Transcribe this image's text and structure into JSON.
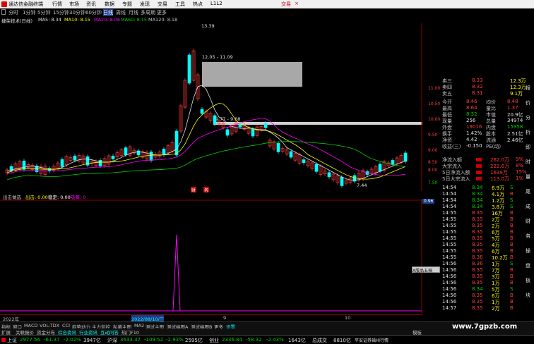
{
  "titlebar": {
    "app_name": "通达信金融终端",
    "menus": [
      "行情",
      "市场",
      "资讯",
      "数据",
      "专题",
      "发现",
      "交易",
      "工具",
      "热点",
      "L1L2"
    ],
    "broker": "交易",
    "close": "×"
  },
  "period_tabs": [
    "分时",
    "1分钟",
    "5分钟",
    "15分钟",
    "30分钟",
    "60分钟",
    "日线",
    "周线",
    "月线",
    "多周期",
    "更多"
  ],
  "period_selected": "日线",
  "ma_legend": [
    {
      "text": "MA5: 8.34",
      "color": "#e0e0e0"
    },
    {
      "text": "MA10: 8.15",
      "color": "#ffff00"
    },
    {
      "text": "MA20: 8.06",
      "color": "#ff00ff"
    },
    {
      "text": "MA60: 8.15",
      "color": "#00d000"
    },
    {
      "text": "MA120: 8.18",
      "color": "#c0c0c0"
    }
  ],
  "stock_title": "捷荣技术(日线)",
  "price_axis": [
    "11.00",
    "10.50",
    "10.00",
    "9.50",
    "9.00",
    "8.50",
    "8.00",
    "7.50"
  ],
  "current_price_tag": "8.20",
  "annotations": {
    "high": "13.39",
    "range1": "12.05 - 11.09",
    "range2": "9.77 - 9.68",
    "low": "7.44"
  },
  "signal_tags": {
    "financial": "财",
    "news": "务"
  },
  "sub_legend": [
    {
      "text": "出击做选",
      "color": "#c0c0c0"
    },
    {
      "text": "出击: 0.00",
      "color": "#ffff00"
    },
    {
      "text": "稳定: 0.00",
      "color": "#ffffff"
    },
    {
      "text": "吸筹: 0",
      "color": "#ff00ff"
    }
  ],
  "sub_axis_value": "0.96",
  "date_axis": [
    {
      "text": "2022年",
      "color": "#c0c0c0"
    },
    {
      "text": "2022/08/10/三",
      "color": "#00ffff"
    },
    {
      "text": "9",
      "color": "#c0c0c0"
    },
    {
      "text": "10",
      "color": "#c0c0c0"
    }
  ],
  "bottom_tabs": [
    "指标",
    "窗口",
    "MACD",
    "VOL-TDX",
    "CCI",
    "趋势动力",
    "主力监控",
    "私募主图",
    "MA2",
    "测试主图",
    "测试幅图A",
    "测试幅图B",
    "更多",
    "设置"
  ],
  "bottom_tabs2": [
    "扩展",
    "关联报价",
    "资金分布",
    "综合资讯",
    "行业资讯",
    "互动问答",
    "热门F10"
  ],
  "bottom_tabs2_right": "模板",
  "status_bar": [
    {
      "label": "上证",
      "value": "2977.56",
      "change": "-61.37",
      "pct": "-2.02%",
      "amount": "3947亿"
    },
    {
      "label": "沪深",
      "value": "3633.37",
      "change": "-109.52",
      "pct": "-2.93%",
      "amount": "2595亿"
    },
    {
      "label": "创业",
      "value": "2336.84",
      "change": "-58.32",
      "pct": "-2.43%",
      "amount": "1643亿"
    }
  ],
  "total_turnover_label": "总成交",
  "total_turnover": "8810亿",
  "status_tail": "平安证券福州行情",
  "watermark": "www.7gpzb.com",
  "quote_panel": {
    "order_book": [
      {
        "label": "卖三",
        "price": "8.33",
        "vol": "12.3万"
      },
      {
        "label": "卖四",
        "price": "8.32",
        "vol": "12.3万"
      },
      {
        "label": "卖五",
        "price": "8.31",
        "vol": "9.1万"
      }
    ],
    "stats": [
      {
        "l1": "今开",
        "v1": "8.46",
        "l2": "均价",
        "v2": "8.48",
        "c1": "#ff3c3c",
        "c2": "#ff3c3c"
      },
      {
        "l1": "最高",
        "v1": "8.64",
        "l2": "量比",
        "v2": "1.37",
        "c1": "#ff3c3c",
        "c2": "#ff3c3c"
      },
      {
        "l1": "最低",
        "v1": "8.32",
        "l2": "市值",
        "v2": "20.9亿",
        "c1": "#00d000",
        "c2": "#e0e0e0"
      },
      {
        "l1": "现量",
        "v1": "256",
        "l2": "总量",
        "v2": "34974",
        "c1": "#e0e0e0",
        "c2": "#e0e0e0"
      },
      {
        "l1": "外盘",
        "v1": "19016",
        "l2": "内盘",
        "v2": "15958",
        "c1": "#ff3c3c",
        "c2": "#00d000"
      },
      {
        "l1": "换手",
        "v1": "1.42%",
        "l2": "股本",
        "v2": "2.51亿",
        "c1": "#e0e0e0",
        "c2": "#e0e0e0"
      },
      {
        "l1": "净资",
        "v1": "4.42",
        "l2": "流通",
        "v2": "2.46亿",
        "c1": "#e0e0e0",
        "c2": "#e0e0e0"
      },
      {
        "l1": "收益(三)",
        "v1": "-0.150",
        "l2": "PE(动)",
        "v2": "",
        "c1": "#e0e0e0",
        "c2": "#e0e0e0"
      }
    ],
    "flows": [
      {
        "label": "净流入额",
        "value": "262.0万",
        "pct": "9%"
      },
      {
        "label": "大宗流入",
        "value": "222.6万",
        "pct": "8%"
      },
      {
        "label": "5日净流入额",
        "value": "1639万",
        "pct": "15%"
      },
      {
        "label": "5日大宗流入",
        "value": "113.0万",
        "pct": "1%"
      }
    ],
    "ticks": [
      {
        "time": "14:54",
        "price": "8.34",
        "vol": "6.9万",
        "flag": "S"
      },
      {
        "time": "14:54",
        "price": "8.34",
        "vol": "4.1万",
        "flag": "B"
      },
      {
        "time": "14:54",
        "price": "8.34",
        "vol": "1.2万",
        "flag": "S"
      },
      {
        "time": "14:54",
        "price": "8.34",
        "vol": "3.8万",
        "flag": "S"
      },
      {
        "time": "14:55",
        "price": "8.35",
        "vol": "16万",
        "flag": "B"
      },
      {
        "time": "14:55",
        "price": "8.35",
        "vol": "2万",
        "flag": "B"
      },
      {
        "time": "14:55",
        "price": "8.35",
        "vol": "2万",
        "flag": "B"
      },
      {
        "time": "14:55",
        "price": "8.35",
        "vol": "6万",
        "flag": "B"
      },
      {
        "time": "14:55",
        "price": "8.35",
        "vol": "5万",
        "flag": "B"
      },
      {
        "time": "14:55",
        "price": "8.35",
        "vol": "4万",
        "flag": "B"
      },
      {
        "time": "14:55",
        "price": "8.35",
        "vol": "6万",
        "flag": "B"
      },
      {
        "time": "14:55",
        "price": "8.36",
        "vol": "10.2万",
        "flag": "B"
      },
      {
        "time": "14:56",
        "price": "8.36",
        "vol": "1万",
        "flag": "S"
      },
      {
        "time": "14:56",
        "price": "8.35",
        "vol": "7万",
        "flag": "B"
      },
      {
        "time": "14:56",
        "price": "8.35",
        "vol": "3万",
        "flag": "B"
      },
      {
        "time": "14:56",
        "price": "8.35",
        "vol": "1万",
        "flag": "B"
      },
      {
        "time": "14:56",
        "price": "8.34",
        "vol": "5万",
        "flag": "S"
      },
      {
        "time": "14:56",
        "price": "8.35",
        "vol": "6万",
        "flag": "B"
      },
      {
        "time": "14:56",
        "price": "8.35",
        "vol": "1万",
        "flag": "B"
      },
      {
        "time": "14:57",
        "price": "8.35",
        "vol": "2万",
        "flag": "B"
      }
    ]
  },
  "popup_label": "A股品五档",
  "right_strip": [
    "报",
    "价",
    "分",
    "析",
    "即",
    "时",
    "量",
    "尾",
    "成",
    "财",
    "务",
    "操",
    "盘",
    "板",
    "块"
  ],
  "colors": {
    "up": "#ff3c3c",
    "down": "#00ffff",
    "bg": "#000000",
    "grid": "#8b0000"
  }
}
